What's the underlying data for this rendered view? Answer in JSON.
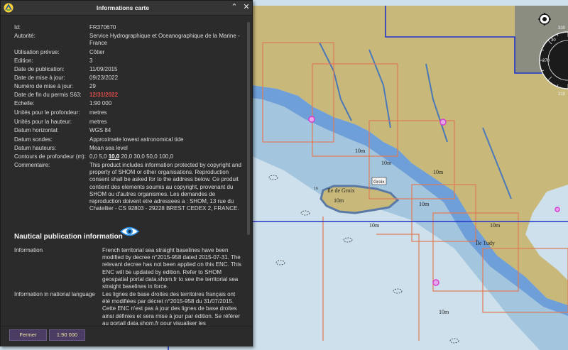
{
  "window": {
    "title": "Informations carte",
    "minimize_glyph": "⌃",
    "close_glyph": "✕"
  },
  "info": [
    {
      "label": "Id:",
      "value": "FR370670"
    },
    {
      "label": "Autorité:",
      "value": "Service Hydrographique et Oceanographique de la Marine - France"
    },
    {
      "label": "Utilisation prévue:",
      "value": "Côtier"
    },
    {
      "label": "Edition:",
      "value": "3"
    },
    {
      "label": "Date de publication:",
      "value": "11/09/2015"
    },
    {
      "label": "Date de mise à jour:",
      "value": "09/23/2022"
    },
    {
      "label": "Numéro de mise à jour:",
      "value": "29"
    },
    {
      "label": "Date de fin du permis S63:",
      "value": "12/31/2022"
    },
    {
      "label": "Echelle:",
      "value": "1:90 000"
    },
    {
      "label": "Unités pour le profondeur:",
      "value": "metres"
    },
    {
      "label": "Unités pour la hauteur:",
      "value": "metres"
    },
    {
      "label": "Datum horizontal:",
      "value": "WGS 84"
    },
    {
      "label": "Datum sondes:",
      "value": "Approximate lowest astronomical tide"
    },
    {
      "label": "Datum hauteurs:",
      "value": "Mean sea level"
    },
    {
      "label": "Contours de profondeur (m):",
      "value_pre": "0,0 5,0 ",
      "value_bold": "10,0",
      "value_post": " 20,0 30,0 50,0 100,0"
    },
    {
      "label": "Commentaire:",
      "value": "This product includes information protected by copyright and property of SHOM or other organisations. Reproduction consent shall be asked for to the address below. Ce produit contient des elements soumis au copyright, provenant du SHOM ou d'autres organismes. Les demandes de reproduction doivent etre adressees a : SHOM, 13 rue du Chatellier - CS 92803 - 29228 BREST CEDEX 2, FRANCE."
    }
  ],
  "nautical": {
    "heading": "Nautical publication information",
    "rows": [
      {
        "label": "Information",
        "value": "French territorial sea straight baselines have been modified by decree n°2015-958 dated 2015-07-31. The relevant decree has not been applied on this ENC. This ENC will be updated by edition. Refer to SHOM geospatial portal data.shom.fr to see the territorial sea straight baselines in force."
      },
      {
        "label": "Information in national language",
        "value": "Les lignes de base droites des territoires français ont été modifiées par décret n°2015-958 du 31/07/2015. Cette ENC n'est pas à jour des lignes de base droites ainsi définies et sera mise à jour par édition. Se référer au portail data.shom.fr pour visualiser les"
      }
    ]
  },
  "footer": {
    "close_label": "Fermer",
    "scale_label": "1:90 000"
  },
  "map": {
    "labels": {
      "island": "Ile de Groix",
      "groix": "Groix",
      "ile_tudy": "Île Tudy",
      "depth_10m": "10m",
      "buoy_16": "16"
    },
    "compass": {
      "n": "330",
      "w": "270",
      "s": "210",
      "e": "30"
    },
    "colors": {
      "land": "#c8b97a",
      "deep_sea": "#cde0ec",
      "mid_sea": "#a3c5de",
      "shallow": "#6f9fd8",
      "chart_limit": "#e07a55",
      "boundary": "#2233cc",
      "panel_bg": "#2b2b2b",
      "s63_expired": "#e24a4a",
      "button": "#4a3c63"
    }
  }
}
